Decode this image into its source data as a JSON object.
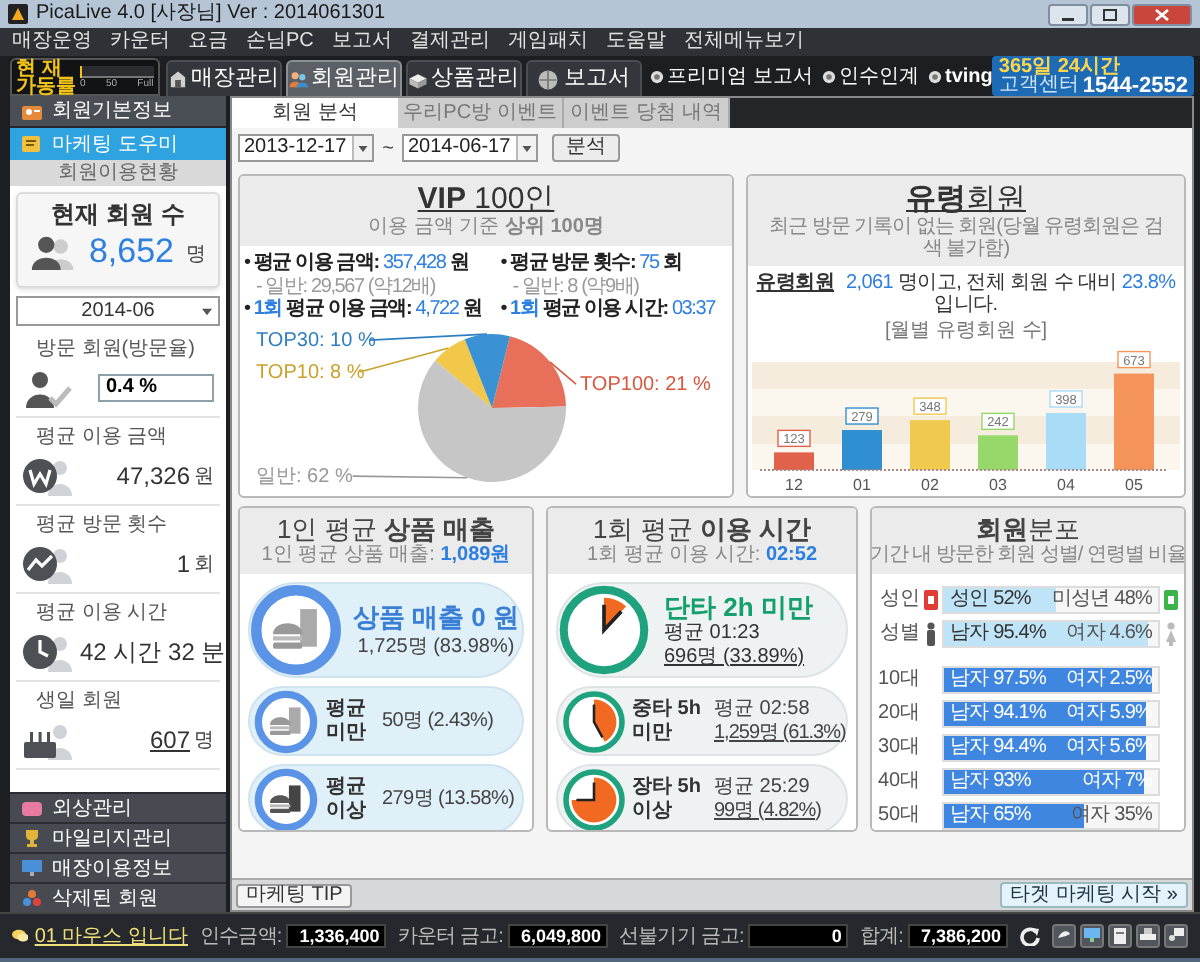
{
  "window": {
    "title": "PicaLive 4.0 [사장님] Ver : 2014061301"
  },
  "menu": [
    "매장운영",
    "카운터",
    "요금",
    "손님PC",
    "보고서",
    "결제관리",
    "게임패치",
    "도움말",
    "전체메뉴보기"
  ],
  "gauge": {
    "label_lines": [
      "현 재",
      "가동률"
    ],
    "ticks": [
      "0",
      "50",
      "Full"
    ],
    "level": 0.03
  },
  "main_tabs": [
    {
      "label": "매장관리",
      "selected": false
    },
    {
      "label": "회원관리",
      "selected": true
    },
    {
      "label": "상품관리",
      "selected": false
    },
    {
      "label": "보고서",
      "selected": false
    }
  ],
  "top_links": [
    "프리미엄 보고서",
    "인수인계",
    "tving"
  ],
  "support_banner": {
    "hours": "365일 24시간",
    "label": "고객센터",
    "phone": "1544-2552"
  },
  "sidebar": {
    "top_items": [
      {
        "label": "회원기본정보",
        "selected": false
      },
      {
        "label": "마케팅 도우미",
        "selected": true
      }
    ],
    "section_title": "회원이용현황",
    "member_count": {
      "label": "현재 회원 수",
      "value": "8,652",
      "unit": "명"
    },
    "month": "2014-06",
    "stats": [
      {
        "kind": "percent",
        "label": "방문 회원(방문율)",
        "value": "0.4 %"
      },
      {
        "kind": "money",
        "label": "평균 이용 금액",
        "value": "47,326",
        "unit": "원"
      },
      {
        "kind": "visits",
        "label": "평균 방문 횟수",
        "value": "1",
        "unit": "회"
      },
      {
        "kind": "time",
        "label": "평균 이용 시간",
        "value": "42 시간 32 분"
      },
      {
        "kind": "birthday",
        "label": "생일 회원",
        "value": "607",
        "unit": "명"
      }
    ],
    "bottom_items": [
      "외상관리",
      "마일리지관리",
      "매장이용정보",
      "삭제된 회원"
    ]
  },
  "sub_tabs": [
    {
      "label": "회원 분석",
      "selected": true
    },
    {
      "label": "우리PC방 이벤트",
      "selected": false
    },
    {
      "label": "이벤트 당첨 내역",
      "selected": false
    }
  ],
  "date_range": {
    "from": "2013-12-17",
    "separator": "~",
    "to": "2014-06-17",
    "button": "분석"
  },
  "vip": {
    "title": "**VIP** 100인",
    "subtitle": "이용 금액 기준 **상위 100명**",
    "stats": [
      {
        "bullet": "•",
        "label": "평균 이용 금액:",
        "value": "357,428",
        "unit": "원",
        "note": "- 일반: 29,567 (약12배)"
      },
      {
        "bullet": "•",
        "label": "평균 방문 횟수:",
        "value": "75",
        "unit": "회",
        "note": "- 일반: 8 (약9배)"
      },
      {
        "bullet": "•",
        "prefix": "1회",
        "label": "평균 이용 금액:",
        "value": "4,722",
        "unit": "원"
      },
      {
        "bullet": "•",
        "prefix": "1회",
        "label": "평균 이용 시간:",
        "value": "03:37"
      }
    ],
    "chart_data": {
      "type": "pie",
      "values": [
        21,
        62,
        8,
        10
      ],
      "value_labels": [
        "TOP100: 21 %",
        "일반: 62 %",
        "TOP10: 8 %",
        "TOP30: 10 %"
      ]
    }
  },
  "ghost": {
    "title": "**유령**회원",
    "subtitle": "최근 방문 기록이 없는 회원(당월 유령회원은 검색 불가함)",
    "summary": {
      "link": "유령회원",
      "count": "2,061",
      "middle": "명이고, 전체 회원 수 대비",
      "ratio": "23.8%",
      "tail": "입니다."
    },
    "chart_data": {
      "type": "bar",
      "title": "[월별 유령회원 수]",
      "categories": [
        "12",
        "01",
        "02",
        "03",
        "04",
        "05"
      ],
      "values": [
        123,
        279,
        348,
        242,
        398,
        673
      ],
      "value_labels": [
        "123",
        "279",
        "348",
        "242",
        "398",
        "673"
      ]
    }
  },
  "sales": {
    "title": "1인 평균 **상품 매출**",
    "subtitle_label": "1인 평균 상품 매출:",
    "subtitle_value": "1,089원",
    "rows": [
      {
        "kind": "main",
        "title": "상품 매출 0 원",
        "detail": "1,725명 (83.98%)"
      },
      {
        "kind": "sub",
        "title": "평균 미만",
        "detail": "50명 (2.43%)"
      },
      {
        "kind": "sub",
        "title": "평균 이상",
        "detail": "279명 (13.58%)"
      }
    ]
  },
  "usage": {
    "title": "1회 평균 **이용 시간**",
    "subtitle_label": "1회 평균 이용 시간:",
    "subtitle_value": "02:52",
    "rows": [
      {
        "kind": "main",
        "title": "단타 2h 미만",
        "avg": "평균 01:23",
        "detail": "696명 (33.89%)"
      },
      {
        "kind": "sub",
        "title": "중타 5h 미만",
        "avg": "평균 02:58",
        "detail": "1,259명 (61.3%)"
      },
      {
        "kind": "sub",
        "title": "장타 5h 이상",
        "avg": "평균 25:29",
        "detail": "99명 (4.82%)"
      }
    ]
  },
  "distribution": {
    "title": "**회원**분포",
    "subtitle": "기간 내 방문한 회원 성별/ 연령별 비율",
    "rows": [
      {
        "kind": "adult",
        "label": "성인",
        "left": "성인 52%",
        "right": "미성년 48%",
        "level": 0.52
      },
      {
        "kind": "gender",
        "label": "성별",
        "left": "남자 95.4%",
        "right": "여자 4.6%",
        "level": 0.954
      },
      {
        "kind": "age",
        "label": "10대",
        "left": "남자 97.5%",
        "right": "여자 2.5%",
        "level": 0.975
      },
      {
        "kind": "age",
        "label": "20대",
        "left": "남자 94.1%",
        "right": "여자 5.9%",
        "level": 0.941
      },
      {
        "kind": "age",
        "label": "30대",
        "left": "남자 94.4%",
        "right": "여자 5.6%",
        "level": 0.944
      },
      {
        "kind": "age",
        "label": "40대",
        "left": "남자 93%",
        "right": "여자 7%",
        "level": 0.93
      },
      {
        "kind": "age",
        "label": "50대",
        "left": "남자 65%",
        "right": "여자 35%",
        "level": 0.65
      }
    ]
  },
  "footer_buttons": {
    "tip": "마케팅 TIP",
    "start": "타겟 마케팅 시작 »"
  },
  "status_bar": {
    "notice": "01 마우스 입니다",
    "fields": [
      {
        "label": "인수금액:",
        "value": "1,336,400"
      },
      {
        "label": "카운터 금고:",
        "value": "6,049,800"
      },
      {
        "label": "선불기기 금고:",
        "value": "0"
      },
      {
        "label": "합계:",
        "value": "7,386,200"
      }
    ]
  }
}
